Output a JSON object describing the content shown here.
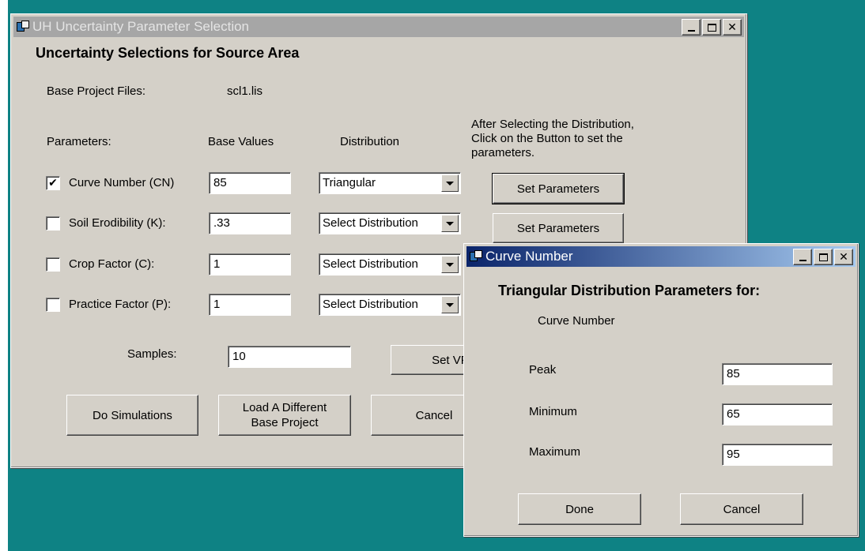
{
  "main_window": {
    "title": "UH Uncertainty Parameter Selection",
    "heading": "Uncertainty Selections for Source Area",
    "base_project_label": "Base Project Files:",
    "base_project_value": "scl1.lis",
    "col_parameters": "Parameters:",
    "col_base_values": "Base Values",
    "col_distribution": "Distribution",
    "instruction": [
      "After Selecting the Distribution,",
      "Click on the Button to set the",
      "parameters."
    ],
    "parameters": [
      {
        "label": "Curve Number (CN)",
        "checked": true,
        "check_mark": "✔",
        "base_value": "85",
        "distribution": "Triangular",
        "button": "Set Parameters"
      },
      {
        "label": "Soil Erodibility (K):",
        "checked": false,
        "check_mark": "",
        "base_value": ".33",
        "distribution": "Select Distribution",
        "button": "Set Parameters"
      },
      {
        "label": "Crop Factor (C):",
        "checked": false,
        "check_mark": "",
        "base_value": "1",
        "distribution": "Select Distribution",
        "button": "Set Parameters"
      },
      {
        "label": "Practice Factor (P):",
        "checked": false,
        "check_mark": "",
        "base_value": "1",
        "distribution": "Select Distribution",
        "button": "Set Parameters"
      }
    ],
    "samples_label": "Samples:",
    "samples_value": "10",
    "set_vfs_button": "Set VFS",
    "do_simulations_button": "Do Simulations",
    "load_project_button": [
      "Load A Different",
      "Base Project"
    ],
    "cancel_button": "Cancel"
  },
  "dialog": {
    "title": "Curve Number",
    "heading": "Triangular Distribution Parameters for:",
    "subheading": "Curve Number",
    "fields": [
      {
        "label": "Peak",
        "value": "85"
      },
      {
        "label": "Minimum",
        "value": "65"
      },
      {
        "label": "Maximum",
        "value": "95"
      }
    ],
    "done_button": "Done",
    "cancel_button": "Cancel"
  },
  "title_buttons": {
    "close_glyph": "✕"
  },
  "colors": {
    "desktop": "#0e8284",
    "window": "#d4d0c8",
    "active_title_start": "#0a246a",
    "active_title_end": "#a6caf0",
    "inactive_title": "#a6a6a6"
  }
}
